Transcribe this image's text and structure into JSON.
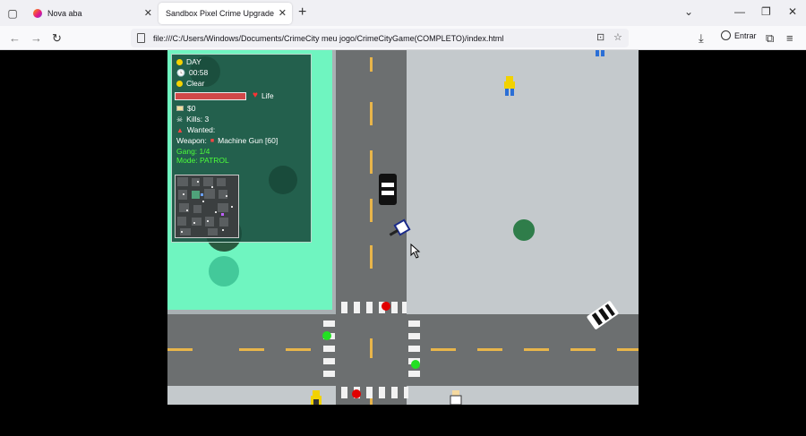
{
  "browser": {
    "tabs": [
      {
        "label": "Nova aba",
        "active": false
      },
      {
        "label": "Sandbox Pixel Crime Upgrade",
        "active": true
      }
    ],
    "url": "file:///C:/Users/Windows/Documents/CrimeCity meu jogo/CrimeCityGame(COMPLETO)/index.html",
    "signin_label": "Entrar"
  },
  "hud": {
    "time_of_day": "DAY",
    "clock": "00:58",
    "weather": "Clear",
    "health_label": "Life",
    "health_fraction": 1.0,
    "money": "$0",
    "kills": "Kills: 3",
    "wanted": "Wanted:",
    "weapon_label": "Weapon:",
    "weapon_name": "Machine Gun [60]",
    "gang": "Gang: 1/4",
    "mode": "Mode: PATROL"
  },
  "colors": {
    "park": "#6ff5c0",
    "road": "#6c6f70",
    "sidewalk": "#c4c9cc",
    "lane_marking": "#e8b54a",
    "traffic_red": "#e00000",
    "traffic_green": "#22e022"
  }
}
